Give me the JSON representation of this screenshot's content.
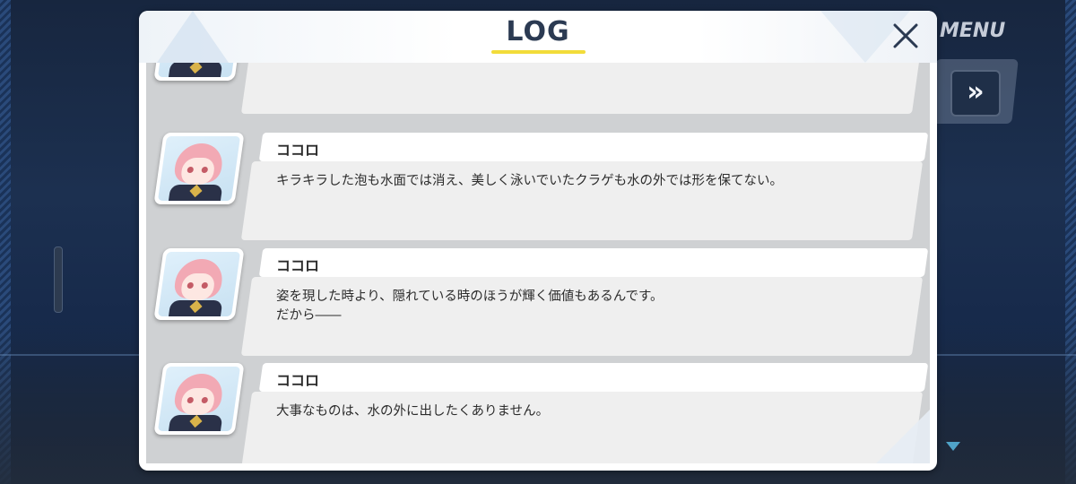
{
  "header": {
    "title": "LOG",
    "menu_label": "MENU",
    "fast_forward_label": "»",
    "accent_color": "#f2dc3a"
  },
  "entries": [
    {
      "speaker": "ココロ",
      "text": "キラキラした泡も水面では消え、美しく泳いでいたクラゲも水の外では形を保てない。",
      "avatar": "kokoro-portrait"
    },
    {
      "speaker": "ココロ",
      "text": "姿を現した時より、隠れている時のほうが輝く価値もあるんです。\nだから――",
      "avatar": "kokoro-portrait"
    },
    {
      "speaker": "ココロ",
      "text": "大事なものは、水の外に出したくありません。",
      "avatar": "kokoro-portrait"
    }
  ],
  "icons": {
    "close": "close-icon",
    "fast_forward": "fast-forward-icon",
    "next": "next-arrow-icon"
  }
}
